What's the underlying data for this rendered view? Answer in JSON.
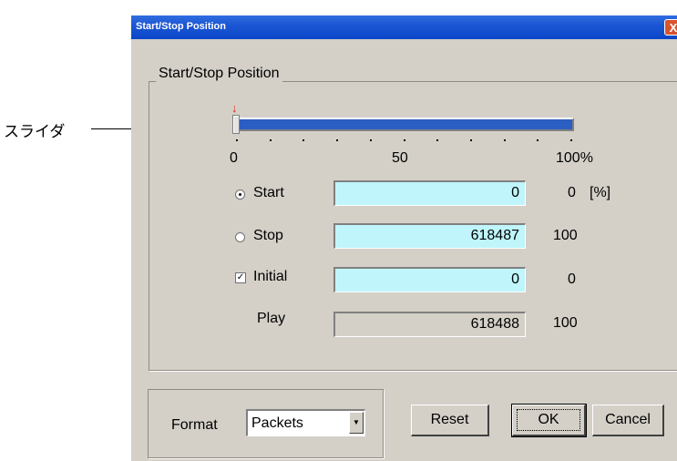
{
  "annotation": {
    "label": "スライダ"
  },
  "window": {
    "title": "Start/Stop Position",
    "close_glyph": "X"
  },
  "group": {
    "title": "Start/Stop Position"
  },
  "slider": {
    "marker_glyph": "↓",
    "position_fraction": 0.0,
    "ticks": [
      "0",
      "50",
      "100%"
    ],
    "minor_tick_count": 11
  },
  "rows": {
    "start": {
      "label": "Start",
      "selected": true,
      "value": "0",
      "percent": "0",
      "unit": "[%]"
    },
    "stop": {
      "label": "Stop",
      "selected": false,
      "value": "618487",
      "percent": "100"
    },
    "initial": {
      "label": "Initial",
      "checked": true,
      "check_glyph": "✓",
      "value": "0",
      "percent": "0"
    },
    "play": {
      "label": "Play",
      "value": "618488",
      "percent": "100"
    }
  },
  "format": {
    "label": "Format",
    "selected": "Packets",
    "arrow_glyph": "▼"
  },
  "buttons": {
    "reset": "Reset",
    "ok": "OK",
    "cancel": "Cancel"
  },
  "colors": {
    "titlebar": "#0a46c8",
    "slider_fill": "#2b5ec2",
    "field_editable": "#bff5fb",
    "dialog_bg": "#d4d0c8",
    "close": "#d9542e"
  }
}
